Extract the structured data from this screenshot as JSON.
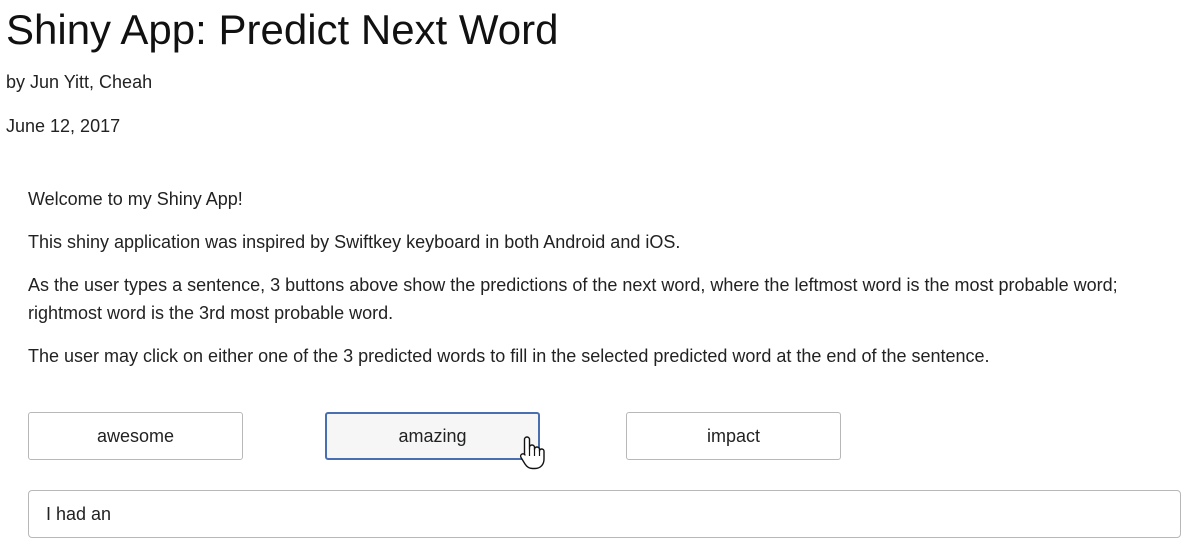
{
  "header": {
    "title": "Shiny App: Predict Next Word",
    "author": "by Jun Yitt, Cheah",
    "date": "June 12, 2017"
  },
  "intro": {
    "p1": "Welcome to my Shiny App!",
    "p2": "This shiny application was inspired by Swiftkey keyboard in both Android and iOS.",
    "p3": "As the user types a sentence, 3 buttons above show the predictions of the next word, where the leftmost word is the most probable word; rightmost word is the 3rd most probable word.",
    "p4": "The user may click on either one of the 3 predicted words to fill in the selected predicted word at the end of the sentence."
  },
  "predictions": {
    "word1": "awesome",
    "word2": "amazing",
    "word3": "impact"
  },
  "sentence": {
    "value": "I had an"
  },
  "colors": {
    "focus_border": "#4a6fb0",
    "button_border": "#b8b8b8"
  },
  "icons": {
    "cursor": "hand-pointer-icon"
  }
}
